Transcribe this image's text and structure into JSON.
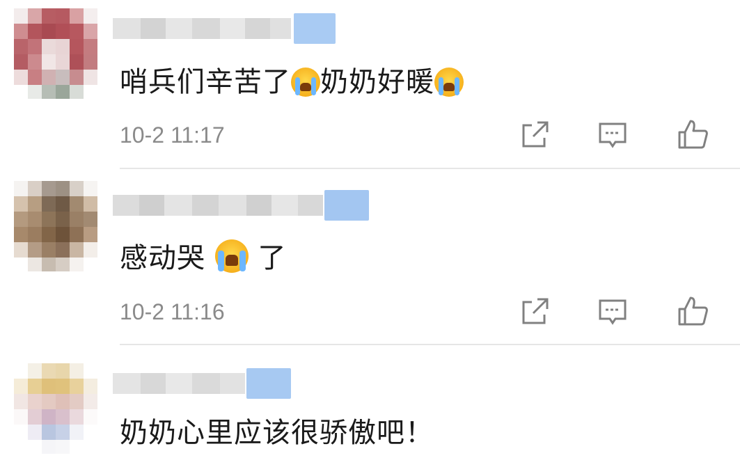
{
  "comments": [
    {
      "text_before": "哨兵们辛苦了",
      "text_middle": "奶奶好暖",
      "emoji": "cry-emoji",
      "time": "10-2 11:17"
    },
    {
      "text_before": "感动哭",
      "text_after": "了",
      "emoji": "loud-cry-emoji",
      "time": "10-2 11:16"
    },
    {
      "text": "奶奶心里应该很骄傲吧！"
    }
  ],
  "icons": {
    "share": "share-icon",
    "reply": "comment-icon",
    "like": "thumbs-up-icon"
  },
  "colors": {
    "text": "#1a1a1a",
    "meta": "#8a8a8a",
    "divider": "#e6e6e6",
    "icon": "#808080",
    "vip_badge": "#9fc4f0"
  }
}
